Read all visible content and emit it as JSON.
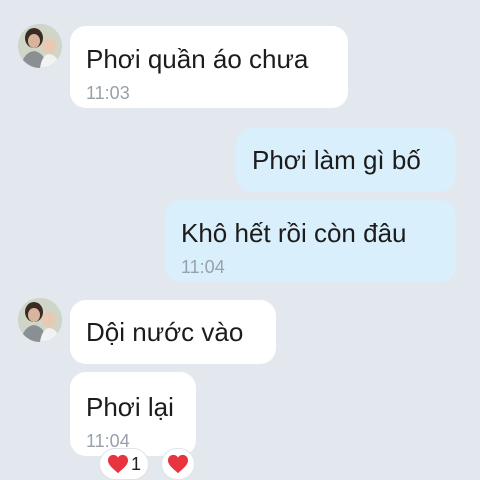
{
  "messages": [
    {
      "text": "Phơi quần áo chưa",
      "time": "11:03"
    },
    {
      "text": "Phơi làm gì bố"
    },
    {
      "text": "Khô hết rồi còn đâu",
      "time": "11:04"
    },
    {
      "text": "Dội nước vào"
    },
    {
      "text": "Phơi lại",
      "time": "11:04"
    }
  ],
  "reactions": [
    {
      "icon": "heart-icon",
      "count": "1"
    },
    {
      "icon": "heart-icon"
    }
  ],
  "colors": {
    "background": "#e3e8ef",
    "incoming_bubble": "#ffffff",
    "outgoing_bubble": "#d9effb",
    "timestamp": "#98a1ab",
    "heart": "#e8343f"
  }
}
